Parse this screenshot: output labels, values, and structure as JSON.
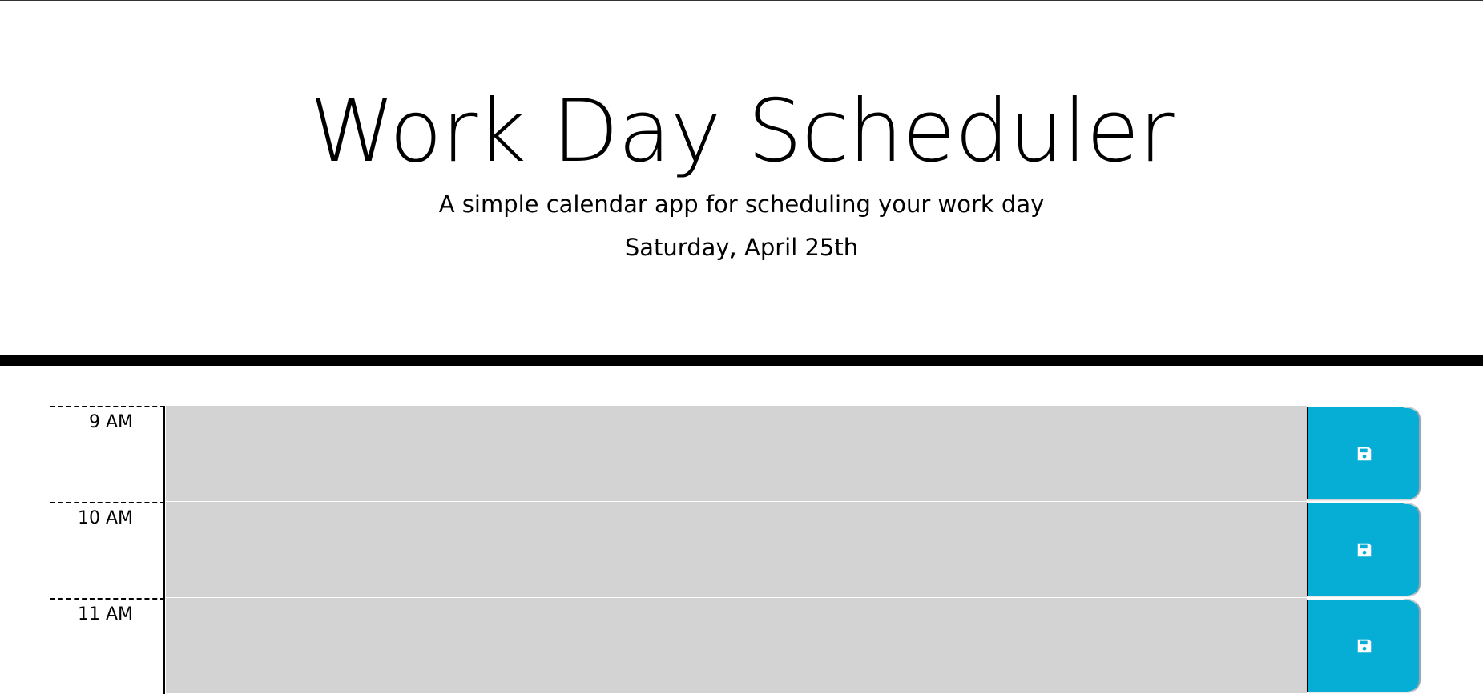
{
  "header": {
    "title": "Work Day Scheduler",
    "subtitle": "A simple calendar app for scheduling your work day",
    "current_day": "Saturday, April 25th"
  },
  "colors": {
    "accent": "#06aed5",
    "past_block": "#d3d3d3",
    "divider": "#000000"
  },
  "schedule": {
    "blocks": [
      {
        "hour": "9 AM",
        "description": "",
        "save_icon": "save-icon"
      },
      {
        "hour": "10 AM",
        "description": "",
        "save_icon": "save-icon"
      },
      {
        "hour": "11 AM",
        "description": "",
        "save_icon": "save-icon"
      }
    ]
  }
}
